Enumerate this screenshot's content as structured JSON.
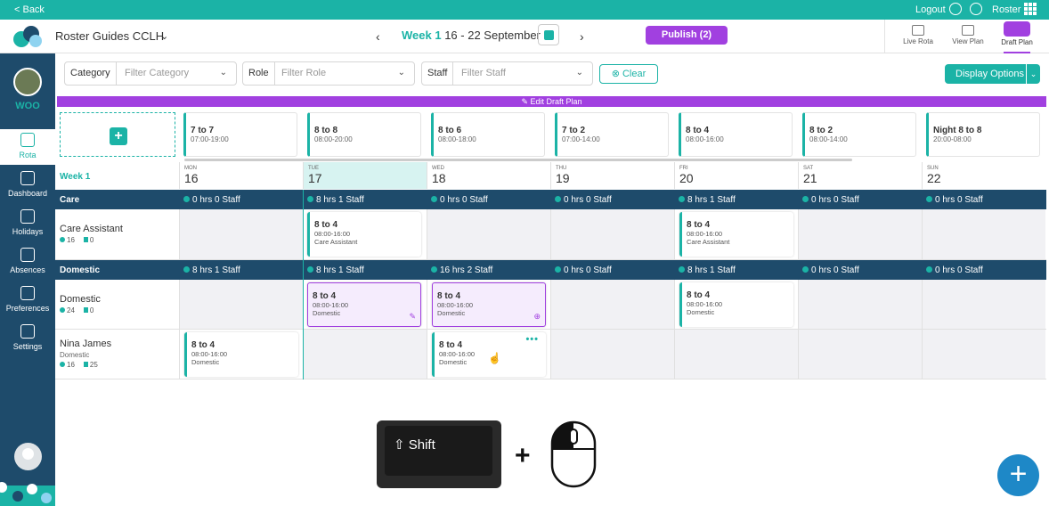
{
  "topbar": {
    "back": "< Back",
    "logout": "Logout",
    "roster": "Roster"
  },
  "header": {
    "org_name": "Roster Guides CCLH",
    "week_label": "Week 1",
    "date_range": "16 - 22 September",
    "publish": "Publish (2)",
    "view_tabs": [
      "Live Rota",
      "View Plan",
      "Draft Plan"
    ]
  },
  "sidebar": {
    "org": "WOO",
    "items": [
      "Rota",
      "Dashboard",
      "Holidays",
      "Absences",
      "Preferences",
      "Settings"
    ]
  },
  "filters": {
    "category_label": "Category",
    "category_placeholder": "Filter Category",
    "role_label": "Role",
    "role_placeholder": "Filter Role",
    "staff_label": "Staff",
    "staff_placeholder": "Filter Staff",
    "clear": "Clear",
    "display_options": "Display Options"
  },
  "edit_bar": "Edit Draft Plan",
  "templates": [
    {
      "title": "7 to 7",
      "time": "07:00-19:00"
    },
    {
      "title": "8 to 8",
      "time": "08:00-20:00"
    },
    {
      "title": "8 to 6",
      "time": "08:00-18:00"
    },
    {
      "title": "7 to 2",
      "time": "07:00-14:00"
    },
    {
      "title": "8 to 4",
      "time": "08:00-16:00"
    },
    {
      "title": "8 to 2",
      "time": "08:00-14:00"
    },
    {
      "title": "Night 8 to 8",
      "time": "20:00-08:00"
    }
  ],
  "week": "Week 1",
  "days": [
    {
      "name": "MON",
      "date": "16"
    },
    {
      "name": "TUE",
      "date": "17"
    },
    {
      "name": "WED",
      "date": "18"
    },
    {
      "name": "THU",
      "date": "19"
    },
    {
      "name": "FRI",
      "date": "20"
    },
    {
      "name": "SAT",
      "date": "21"
    },
    {
      "name": "SUN",
      "date": "22"
    }
  ],
  "groups": [
    {
      "name": "Care",
      "cells": [
        "0 hrs  0 Staff",
        "8 hrs  1 Staff",
        "0 hrs  0 Staff",
        "0 hrs  0 Staff",
        "8 hrs  1 Staff",
        "0 hrs  0 Staff",
        "0 hrs  0 Staff"
      ]
    },
    {
      "name": "Domestic",
      "cells": [
        "8 hrs  1 Staff",
        "8 hrs  1 Staff",
        "16 hrs  2 Staff",
        "0 hrs  0 Staff",
        "8 hrs  1 Staff",
        "0 hrs  0 Staff",
        "0 hrs  0 Staff"
      ]
    }
  ],
  "rows": {
    "care_assistant": {
      "name": "Care Assistant",
      "hours": "16",
      "count": "0"
    },
    "domestic": {
      "name": "Domestic",
      "hours": "24",
      "count": "0"
    },
    "nina": {
      "name": "Nina James",
      "role": "Domestic",
      "hours": "16",
      "count": "25"
    }
  },
  "shifts": {
    "care_tue": {
      "title": "8 to 4",
      "time": "08:00-16:00",
      "role": "Care Assistant"
    },
    "care_fri": {
      "title": "8 to 4",
      "time": "08:00-16:00",
      "role": "Care Assistant"
    },
    "dom_tue": {
      "title": "8 to 4",
      "time": "08:00-16:00",
      "role": "Domestic"
    },
    "dom_wed": {
      "title": "8 to 4",
      "time": "08:00-16:00",
      "role": "Domestic"
    },
    "dom_fri": {
      "title": "8 to 4",
      "time": "08:00-16:00",
      "role": "Domestic"
    },
    "nina_mon": {
      "title": "8 to 4",
      "time": "08:00-16:00",
      "role": "Domestic"
    },
    "nina_wed": {
      "title": "8 to 4",
      "time": "08:00-16:00",
      "role": "Domestic"
    }
  },
  "overlay": {
    "key": "⇧ Shift",
    "plus": "+"
  },
  "fab": "+",
  "colors": {
    "teal": "#1bb3a6",
    "navy": "#1e4b6b",
    "purple": "#a140e0"
  }
}
